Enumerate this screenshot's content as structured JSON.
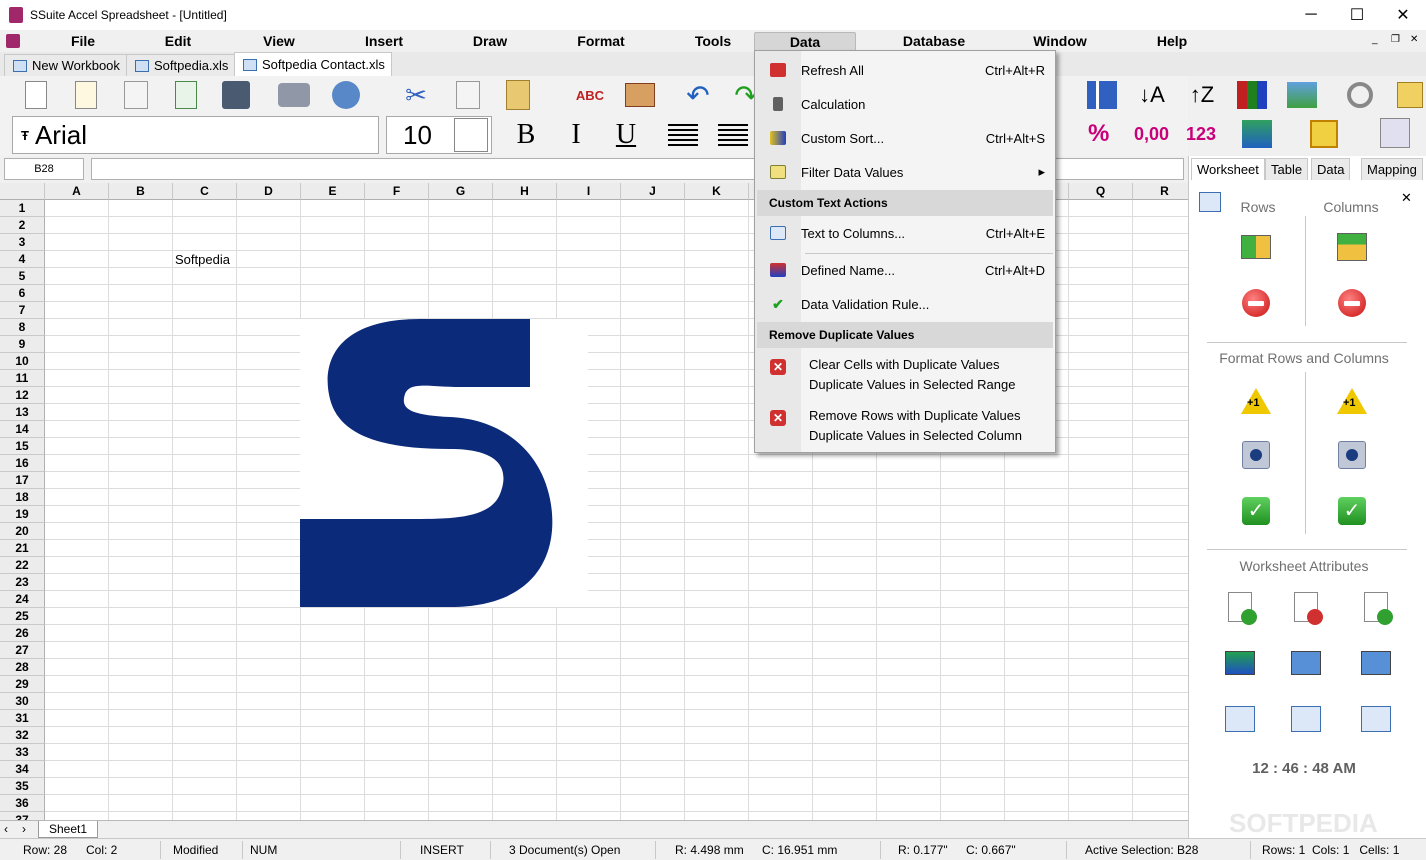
{
  "window": {
    "title": "SSuite Accel Spreadsheet - [Untitled]",
    "minimize": "─",
    "maximize": "☐",
    "close": "✕"
  },
  "menu": [
    "File",
    "Edit",
    "View",
    "Insert",
    "Draw",
    "Format",
    "Tools",
    "Data",
    "Database",
    "Window",
    "Help"
  ],
  "mdi": {
    "minimize": "_",
    "restore": "❐",
    "close": "✕"
  },
  "tabs": [
    "New Workbook",
    "Softpedia.xls",
    "Softpedia Contact.xls"
  ],
  "toolbar": {
    "font": "Arial",
    "size": "10",
    "bold": "B",
    "italic": "I",
    "underline": "U",
    "percent": "%",
    "decimal": "0,00",
    "number": "123"
  },
  "namebox": "B28",
  "columns": [
    "A",
    "B",
    "C",
    "D",
    "E",
    "F",
    "G",
    "H",
    "I",
    "J",
    "K",
    "L",
    "M",
    "N",
    "O",
    "P",
    "Q",
    "R"
  ],
  "rows": [
    "1",
    "2",
    "3",
    "4",
    "5",
    "6",
    "7",
    "8",
    "9",
    "10",
    "11",
    "12",
    "13",
    "14",
    "15",
    "16",
    "17",
    "18",
    "19",
    "20",
    "21",
    "22",
    "23",
    "24",
    "25",
    "26",
    "27",
    "28",
    "29",
    "30",
    "31",
    "32",
    "33",
    "34",
    "35",
    "36",
    "37"
  ],
  "cells": {
    "C4": "Softpedia"
  },
  "sheet_tabs": [
    "Sheet1"
  ],
  "data_menu": {
    "items": [
      {
        "label": "Refresh All",
        "shortcut": "Ctrl+Alt+R"
      },
      {
        "label": "Calculation",
        "shortcut": ""
      },
      {
        "label": "Custom Sort...",
        "shortcut": "Ctrl+Alt+S"
      },
      {
        "label": "Filter Data Values",
        "shortcut": "▸"
      }
    ],
    "header1": "Custom Text Actions",
    "items2": [
      {
        "label": "Text to Columns...",
        "shortcut": "Ctrl+Alt+E"
      },
      {
        "label": "Defined Name...",
        "shortcut": "Ctrl+Alt+D"
      },
      {
        "label": "Data Validation Rule...",
        "shortcut": ""
      }
    ],
    "header2": "Remove Duplicate Values",
    "items3": [
      {
        "line1": "Clear Cells with Duplicate Values",
        "line2": "Duplicate Values in Selected Range"
      },
      {
        "line1": "Remove Rows with Duplicate Values",
        "line2": "Duplicate Values in Selected Column"
      }
    ]
  },
  "panel": {
    "tabs": [
      "Worksheet",
      "Table",
      "Data",
      "Mapping"
    ],
    "close": "✕",
    "rows_label": "Rows",
    "columns_label": "Columns",
    "format_label": "Format Rows and Columns",
    "plus_one": "+1",
    "attributes_label": "Worksheet Attributes",
    "clock": "12 : 46 : 48 AM",
    "watermark": "SOFTPEDIA"
  },
  "status": {
    "row": "Row:  28",
    "col": "Col:   2",
    "modified": "Modified",
    "num": "NUM",
    "insert": "INSERT",
    "docs": "3 Document(s) Open",
    "rmm": "R: 4.498 mm",
    "cmm": "C: 16.951 mm",
    "rin": "R: 0.177\"",
    "cin": "C: 0.667\"",
    "active": "Active Selection: B28",
    "counts": "Rows: 1  Cols: 1   Cells: 1"
  },
  "colors": {
    "logo": "#0b2a7a",
    "accent": "#c8007a"
  }
}
